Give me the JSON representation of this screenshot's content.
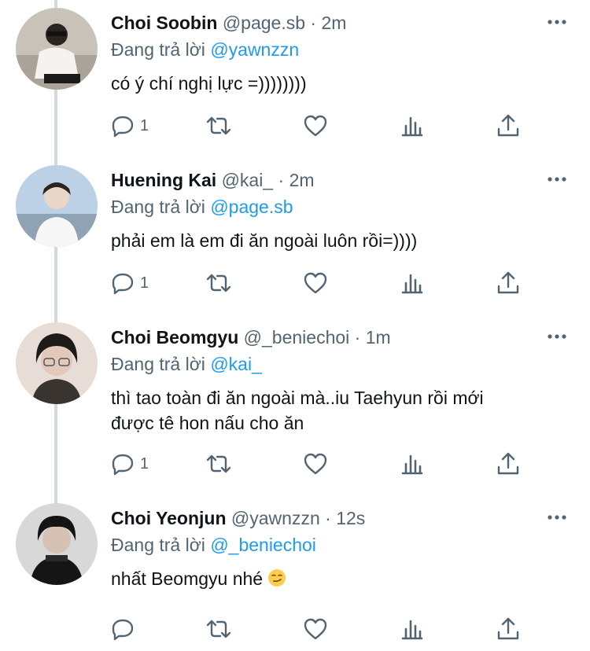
{
  "tweets": [
    {
      "name": "Choi Soobin",
      "handle": "@page.sb",
      "sep": "·",
      "time": "2m",
      "replying_label": "Đang trả lời",
      "replying_to": "@yawnzzn",
      "text": "có ý chí nghị lực =))))))))",
      "reply_count": "1",
      "avatar_color": "#c9c2b8"
    },
    {
      "name": "Huening Kai",
      "handle": "@kai_",
      "sep": "·",
      "time": "2m",
      "replying_label": "Đang trả lời",
      "replying_to": "@page.sb",
      "text": "phải em là em đi ăn ngoài luôn rồi=))))",
      "reply_count": "1",
      "avatar_color": "#bcd0e6"
    },
    {
      "name": "Choi Beomgyu",
      "handle": "@_beniechoi",
      "sep": "·",
      "time": "1m",
      "replying_label": "Đang trả lời",
      "replying_to": "@kai_",
      "text_line1": "thì tao toàn đi ăn ngoài mà..iu Taehyun rồi mới",
      "text_line2": "được tê hon nấu cho ăn",
      "reply_count": "1",
      "avatar_color": "#e8dcd6"
    },
    {
      "name": "Choi Yeonjun",
      "handle": "@yawnzzn",
      "sep": "·",
      "time": "12s",
      "replying_label": "Đang trả lời",
      "replying_to": "@_beniechoi",
      "text": "nhất Beomgyu nhé",
      "reply_count": "",
      "avatar_color": "#d8d8d8"
    }
  ],
  "colors": {
    "accent": "#1d9bf0",
    "muted": "#536471",
    "text": "#0f1419",
    "thread": "#cfd9de"
  },
  "icons": [
    "more-icon",
    "reply-icon",
    "retweet-icon",
    "like-icon",
    "views-icon",
    "share-icon",
    "smirk-emoji-icon"
  ]
}
